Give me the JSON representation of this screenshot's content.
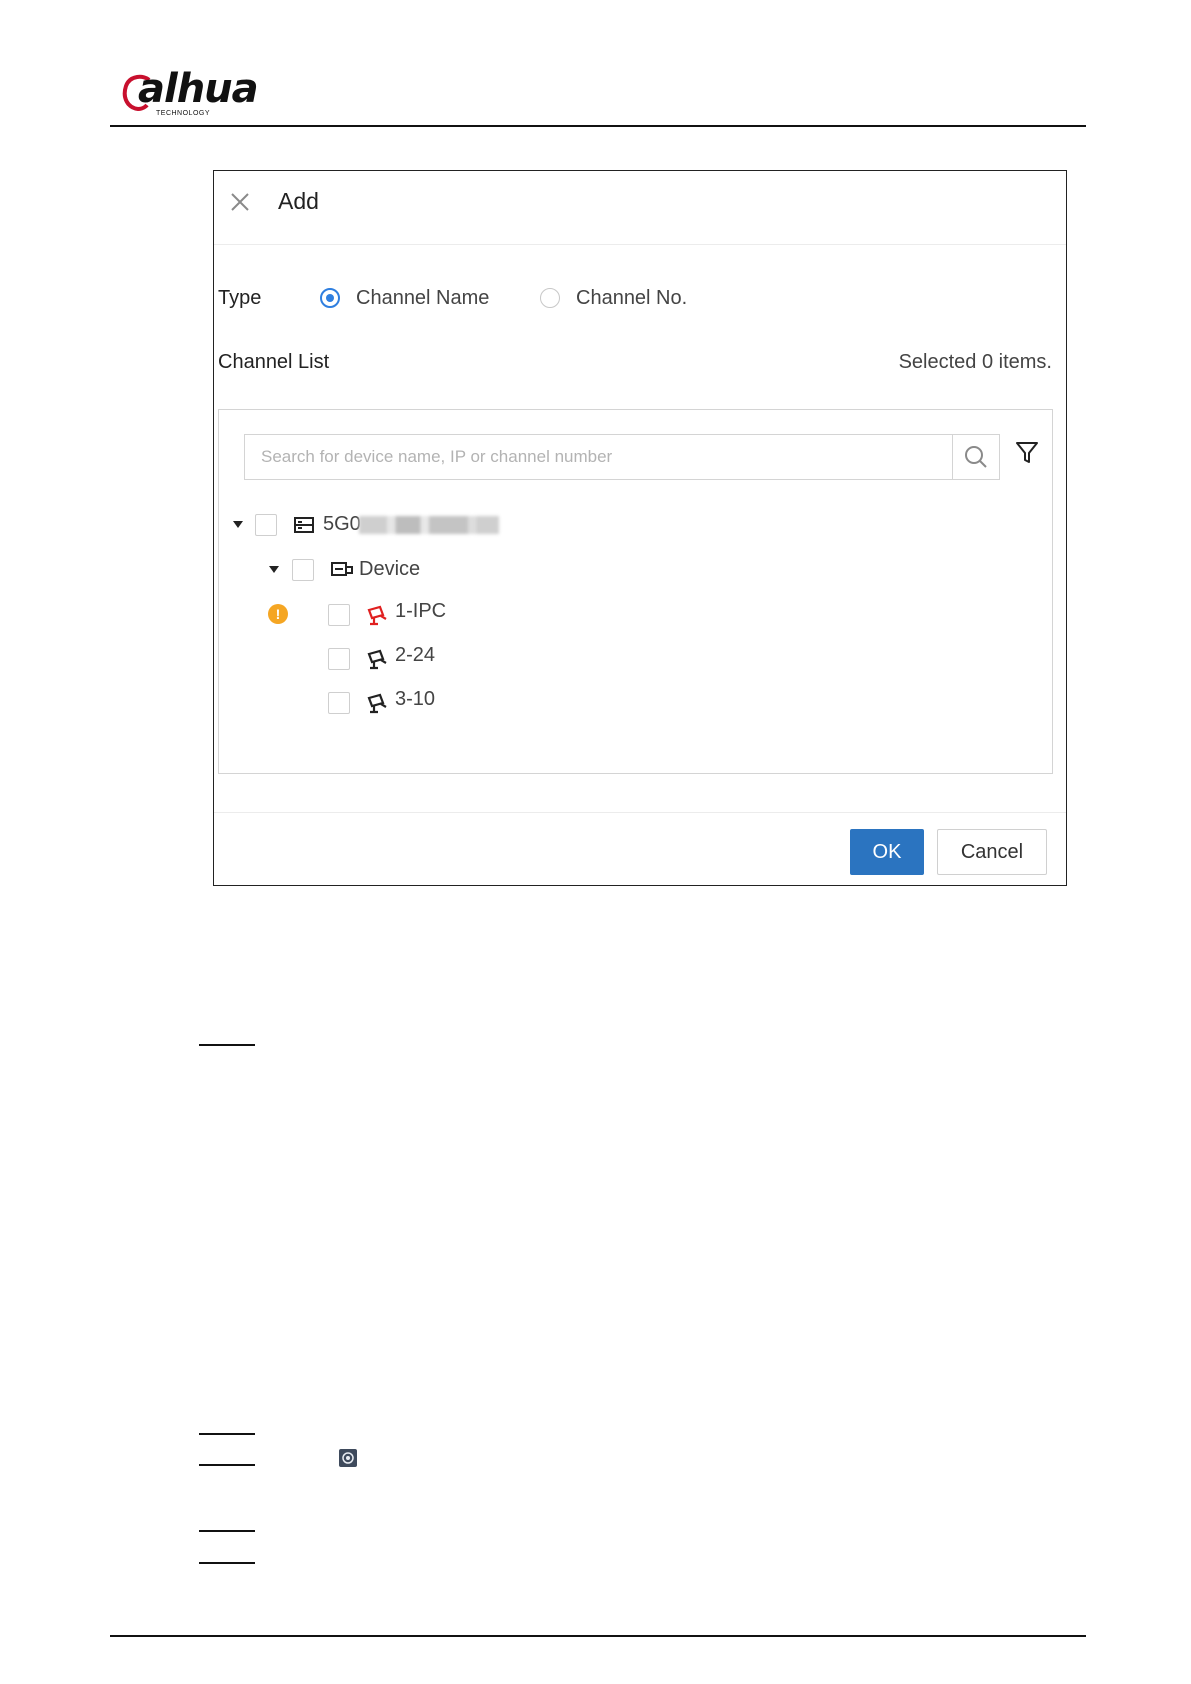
{
  "header": {
    "logo_text": "alhua",
    "logo_subtext": "TECHNOLOGY"
  },
  "dialog": {
    "title": "Add",
    "type_label": "Type",
    "radio_options": [
      {
        "label": "Channel Name",
        "selected": true
      },
      {
        "label": "Channel No.",
        "selected": false
      }
    ],
    "channel_list_label": "Channel List",
    "selected_text": "Selected 0 items.",
    "search_placeholder": "Search for device name, IP or channel number",
    "tree": {
      "root": {
        "label": "5G0",
        "expanded": true,
        "checked": false
      },
      "group": {
        "label": "Device",
        "expanded": true,
        "checked": false
      },
      "channels": [
        {
          "label": "1-IPC",
          "status": "warning",
          "icon": "camera-offline-icon",
          "icon_color": "#e02020"
        },
        {
          "label": "2-24",
          "status": "normal",
          "icon": "camera-icon",
          "icon_color": "#222222"
        },
        {
          "label": "3-10",
          "status": "normal",
          "icon": "camera-icon",
          "icon_color": "#222222"
        }
      ]
    },
    "ok_label": "OK",
    "cancel_label": "Cancel",
    "accent_color": "#2b74c0"
  }
}
